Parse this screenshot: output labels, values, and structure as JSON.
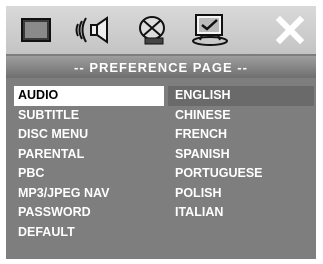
{
  "toolbar": {
    "icons": [
      "display-icon",
      "speaker-icon",
      "disc-icon",
      "preference-icon",
      "close-icon"
    ]
  },
  "title": "-- PREFERENCE PAGE --",
  "menu": {
    "items": [
      "AUDIO",
      "SUBTITLE",
      "DISC MENU",
      "PARENTAL",
      "PBC",
      "MP3/JPEG NAV",
      "PASSWORD",
      "DEFAULT"
    ],
    "selected": "AUDIO"
  },
  "options": {
    "items": [
      "ENGLISH",
      "CHINESE",
      "FRENCH",
      "SPANISH",
      "PORTUGUESE",
      "POLISH",
      "ITALIAN"
    ],
    "highlighted": "ENGLISH"
  },
  "colors": {
    "background": "#7e7e7e",
    "toolbar": "#cfcfcf",
    "selected_bg": "#ffffff",
    "text": "#ffffff"
  }
}
